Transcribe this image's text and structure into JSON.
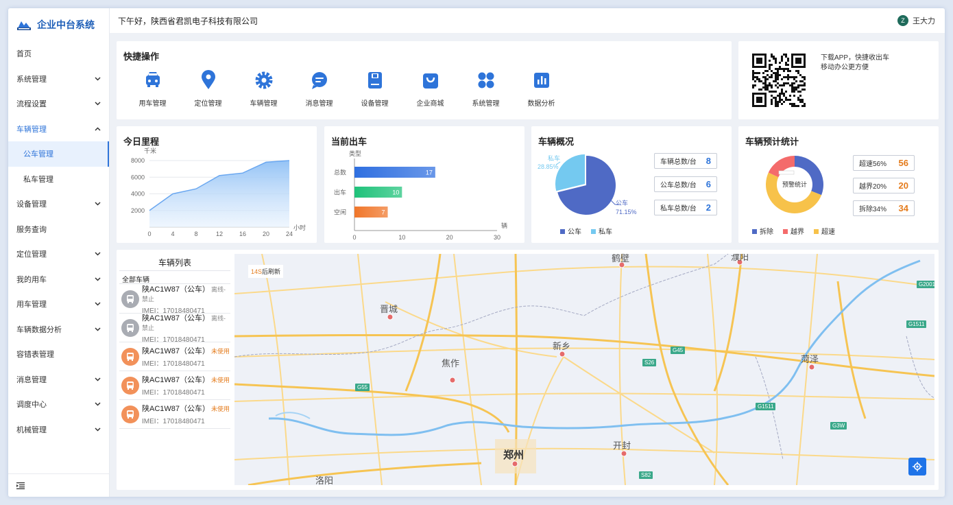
{
  "app": {
    "title": "企业中台系统"
  },
  "header": {
    "greeting": "下午好，陕西省君凯电子科技有限公司",
    "user_initial": "Z",
    "user_name": "王大力"
  },
  "sidebar": {
    "items": [
      {
        "label": "首页",
        "chevron": ""
      },
      {
        "label": "系统管理",
        "chevron": "down"
      },
      {
        "label": "流程设置",
        "chevron": "down"
      },
      {
        "label": "车辆管理",
        "chevron": "up"
      },
      {
        "label": "公车管理",
        "chevron": ""
      },
      {
        "label": "私车管理",
        "chevron": ""
      },
      {
        "label": "设备管理",
        "chevron": "down"
      },
      {
        "label": "服务查询",
        "chevron": ""
      },
      {
        "label": "定位管理",
        "chevron": "down"
      },
      {
        "label": "我的用车",
        "chevron": "down"
      },
      {
        "label": "用车管理",
        "chevron": "down"
      },
      {
        "label": "车辆数据分析",
        "chevron": "down"
      },
      {
        "label": "容错表管理",
        "chevron": ""
      },
      {
        "label": "消息管理",
        "chevron": "down"
      },
      {
        "label": "调度中心",
        "chevron": "down"
      },
      {
        "label": "机械管理",
        "chevron": "down"
      }
    ]
  },
  "quick_actions": {
    "title": "快捷操作",
    "items": [
      {
        "label": "用车管理",
        "icon": "car-icon"
      },
      {
        "label": "定位管理",
        "icon": "location-pin-icon"
      },
      {
        "label": "车辆管理",
        "icon": "gear-icon"
      },
      {
        "label": "消息管理",
        "icon": "message-icon"
      },
      {
        "label": "设备管理",
        "icon": "device-icon"
      },
      {
        "label": "企业商城",
        "icon": "shopping-bag-icon"
      },
      {
        "label": "系统管理",
        "icon": "grid-icon"
      },
      {
        "label": "数据分析",
        "icon": "bar-chart-icon"
      }
    ]
  },
  "download": {
    "line1": "下载APP，快捷收出车",
    "line2": "移动办公更方便"
  },
  "mileage": {
    "title": "今日里程",
    "ylabel": "千米",
    "xlabel": "小时"
  },
  "departures": {
    "title": "当前出车",
    "ylabel": "类型",
    "xlabel": "辆"
  },
  "overview": {
    "title": "车辆概况",
    "stats": [
      {
        "label": "车辆总数/台",
        "value": "8"
      },
      {
        "label": "公车总数/台",
        "value": "6"
      },
      {
        "label": "私车总数/台",
        "value": "2"
      }
    ],
    "slice_labels": [
      {
        "name": "公车",
        "pct": "71.15%"
      },
      {
        "name": "私车",
        "pct": "28.85%"
      }
    ],
    "legend": [
      "公车",
      "私车"
    ]
  },
  "forecast": {
    "title": "车辆预计统计",
    "center": "预警统计",
    "stats": [
      {
        "label": "超速56%",
        "value": "56"
      },
      {
        "label": "越界20%",
        "value": "20"
      },
      {
        "label": "拆除34%",
        "value": "34"
      }
    ],
    "legend": [
      "拆除",
      "越界",
      "超速"
    ]
  },
  "vehicle_list": {
    "title": "车辆列表",
    "all": "全部车辆",
    "rows": [
      {
        "name": "陕AC1W87（公车）",
        "status": "离线-禁止",
        "imei": "IMEI：17018480471",
        "state": "offline"
      },
      {
        "name": "陕AC1W87（公车）",
        "status": "离线-禁止",
        "imei": "IMEI：17018480471",
        "state": "offline"
      },
      {
        "name": "陕AC1W87（公车）",
        "status": "未使用",
        "imei": "IMEI：17018480471",
        "state": "unused"
      },
      {
        "name": "陕AC1W87（公车）",
        "status": "未使用",
        "imei": "IMEI：17018480471",
        "state": "unused"
      },
      {
        "name": "陕AC1W87（公车）",
        "status": "未使用",
        "imei": "IMEI：17018480471",
        "state": "unused"
      }
    ]
  },
  "map": {
    "refresh_count": "14S",
    "refresh_text": "后刷新",
    "cities": [
      "鹤壁",
      "濮阳",
      "晋城",
      "新乡",
      "焦作",
      "菏泽",
      "开封",
      "郑州",
      "洛阳"
    ],
    "roads": [
      "G2001",
      "G1511",
      "G45",
      "S26",
      "G55",
      "G1511",
      "G3W",
      "S82"
    ]
  },
  "chart_data": [
    {
      "type": "area",
      "title": "今日里程",
      "ylabel": "千米",
      "xlabel": "小时",
      "x": [
        0,
        4,
        8,
        12,
        16,
        20,
        24
      ],
      "values": [
        2000,
        4000,
        4600,
        6200,
        6500,
        7800,
        8000
      ],
      "xticks": [
        0,
        4,
        8,
        12,
        16,
        20,
        24
      ],
      "yticks": [
        2000,
        4000,
        6000,
        8000
      ],
      "ylim": [
        0,
        8000
      ],
      "xlim": [
        0,
        24
      ],
      "grid": true
    },
    {
      "type": "bar",
      "orientation": "horizontal",
      "title": "当前出车",
      "ylabel": "类型",
      "xlabel": "辆",
      "categories": [
        "总数",
        "出车",
        "空闲"
      ],
      "values": [
        17,
        10,
        7
      ],
      "colors": [
        "#2f6fe0",
        "#1fc27a",
        "#f0762a"
      ],
      "xticks": [
        0,
        10,
        20,
        30
      ],
      "xlim": [
        0,
        30
      ]
    },
    {
      "type": "pie",
      "title": "车辆概况",
      "categories": [
        "公车",
        "私车"
      ],
      "values": [
        71.15,
        28.85
      ],
      "colors": [
        "#4f6ac5",
        "#74c9f0"
      ],
      "legend": "bottom"
    },
    {
      "type": "pie",
      "title": "车辆预计统计",
      "donut": true,
      "categories": [
        "拆除",
        "越界",
        "超速"
      ],
      "values": [
        34,
        20,
        56
      ],
      "colors": [
        "#4f6ac5",
        "#f46b6b",
        "#f7c24a"
      ],
      "legend": "bottom"
    }
  ],
  "colors": {
    "primary": "#2e74d9",
    "accent_orange": "#e47b1c"
  }
}
